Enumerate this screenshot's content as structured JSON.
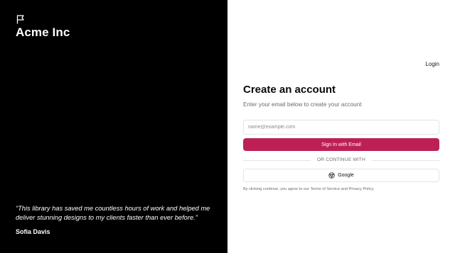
{
  "brand": {
    "name": "Acme Inc",
    "icon": "flag-icon"
  },
  "testimonial": {
    "quote": "“This library has saved me countless hours of work and helped me deliver stunning designs to my clients faster than ever before.”",
    "author": "Sofia Davis"
  },
  "header": {
    "login_label": "Login"
  },
  "form": {
    "title": "Create an account",
    "subtitle": "Enter your email below to create your account",
    "email_placeholder": "name@example.com",
    "email_value": "",
    "signin_label": "Sign In with Email",
    "divider_label": "OR CONTINUE WITH",
    "google_label": "Google",
    "google_icon": "google-icon"
  },
  "terms": {
    "prefix": "By clicking continue, you agree to our ",
    "tos_label": "Terms of Service",
    "and": " and ",
    "privacy_label": "Privacy Policy",
    "suffix": "."
  },
  "colors": {
    "left_bg": "#000000",
    "accent": "#bd2055",
    "border": "#e4e4e7",
    "muted_text": "#6b6b73"
  }
}
